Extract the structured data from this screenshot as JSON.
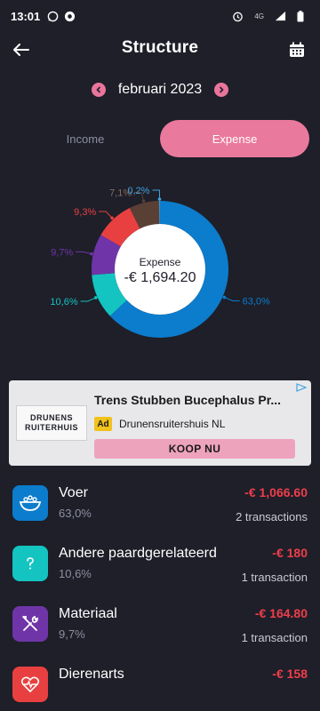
{
  "status": {
    "time": "13:01",
    "network": "4G"
  },
  "header": {
    "title": "Structure"
  },
  "period": {
    "month_label": "februari 2023"
  },
  "tabs": {
    "income": "Income",
    "expense": "Expense"
  },
  "colors": {
    "background": "#1e1f29",
    "accent_pink": "#e9799d",
    "negative": "#ee3e4a",
    "voer": "#0c7ccc",
    "andere": "#14c4c1",
    "materiaal": "#6f35a8",
    "dierenarts": "#e84040",
    "segment_71": "#5a3f35",
    "segment_02": "#3fa3e0"
  },
  "chart_data": {
    "type": "pie",
    "donut": true,
    "center_label": "Expense",
    "center_value": "-€ 1,694.20",
    "slices": [
      {
        "value": 63.0,
        "label": "63,0%",
        "color": "#0c7ccc"
      },
      {
        "value": 10.6,
        "label": "10,6%",
        "color": "#14c4c1"
      },
      {
        "value": 9.7,
        "label": "9,7%",
        "color": "#6f35a8"
      },
      {
        "value": 9.3,
        "label": "9,3%",
        "color": "#e84040"
      },
      {
        "value": 7.1,
        "label": "7,1%",
        "color": "#5a3f35"
      },
      {
        "value": 0.2,
        "label": "0,2%",
        "color": "#3fa3e0"
      }
    ]
  },
  "ad": {
    "title": "Trens Stubben Bucephalus Pr...",
    "badge": "Ad",
    "source": "Drunensruitershuis NL",
    "cta": "KOOP NU",
    "logo_line1": "DRUNENS",
    "logo_line2": "RUITERHUIS"
  },
  "categories": [
    {
      "name": "Voer",
      "pct": "63,0%",
      "amount": "-€ 1,066.60",
      "transactions": "2 transactions",
      "icon": "feed-bowl-icon",
      "color": "#0c7ccc"
    },
    {
      "name": "Andere paardgerelateerd",
      "pct": "10,6%",
      "amount": "-€ 180",
      "transactions": "1 transaction",
      "icon": "question-icon",
      "color": "#14c4c1"
    },
    {
      "name": "Materiaal",
      "pct": "9,7%",
      "amount": "-€ 164.80",
      "transactions": "1 transaction",
      "icon": "tools-icon",
      "color": "#6f35a8"
    },
    {
      "name": "Dierenarts",
      "pct": "",
      "amount": "-€ 158",
      "transactions": "",
      "icon": "heartbeat-icon",
      "color": "#e84040"
    }
  ]
}
